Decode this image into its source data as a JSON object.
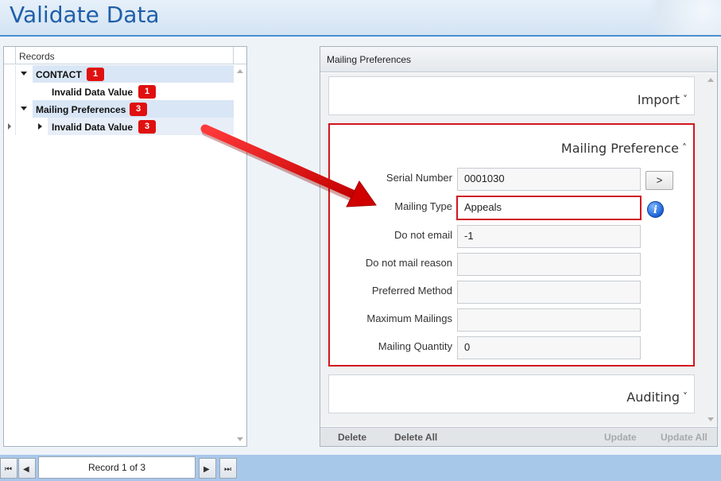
{
  "window": {
    "title": "Validate Data"
  },
  "records_tree": {
    "header": "Records",
    "items": [
      {
        "label": "CONTACT",
        "count": "1",
        "level": 0,
        "expanded": true
      },
      {
        "label": "Invalid Data Value",
        "count": "1",
        "level": 1,
        "expanded": null
      },
      {
        "label": "Mailing Preferences",
        "count": "3",
        "level": 0,
        "expanded": true
      },
      {
        "label": "Invalid Data Value",
        "count": "3",
        "level": 1,
        "expanded": false,
        "selected": true
      }
    ]
  },
  "detail": {
    "header": "Mailing Preferences",
    "sections": {
      "import": {
        "title": "Import",
        "chevron": "˅"
      },
      "mailing_preference": {
        "title": "Mailing Preference",
        "chevron": "˄"
      },
      "auditing": {
        "title": "Auditing",
        "chevron": "˅"
      }
    },
    "fields": [
      {
        "label": "Serial Number",
        "value": "0001030"
      },
      {
        "label": "Mailing Type",
        "value": "Appeals",
        "highlighted": true
      },
      {
        "label": "Do not email",
        "value": "-1"
      },
      {
        "label": "Do not mail reason",
        "value": ""
      },
      {
        "label": "Preferred Method",
        "value": ""
      },
      {
        "label": "Maximum Mailings",
        "value": ""
      },
      {
        "label": "Mailing Quantity",
        "value": "0"
      }
    ],
    "go_button": ">",
    "info_icon": "i",
    "footer": {
      "delete": "Delete",
      "delete_all": "Delete All",
      "update": "Update",
      "update_all": "Update All"
    }
  },
  "navigator": {
    "record_text": "Record 1 of 3",
    "first": "⏮",
    "prev": "◀",
    "next": "▶",
    "last": "⏭"
  },
  "colors": {
    "accent_blue": "#1f5fa8",
    "badge_red": "#e01010",
    "highlight_red": "#d0161f",
    "tree_row_bg": "#d9e6f5"
  }
}
